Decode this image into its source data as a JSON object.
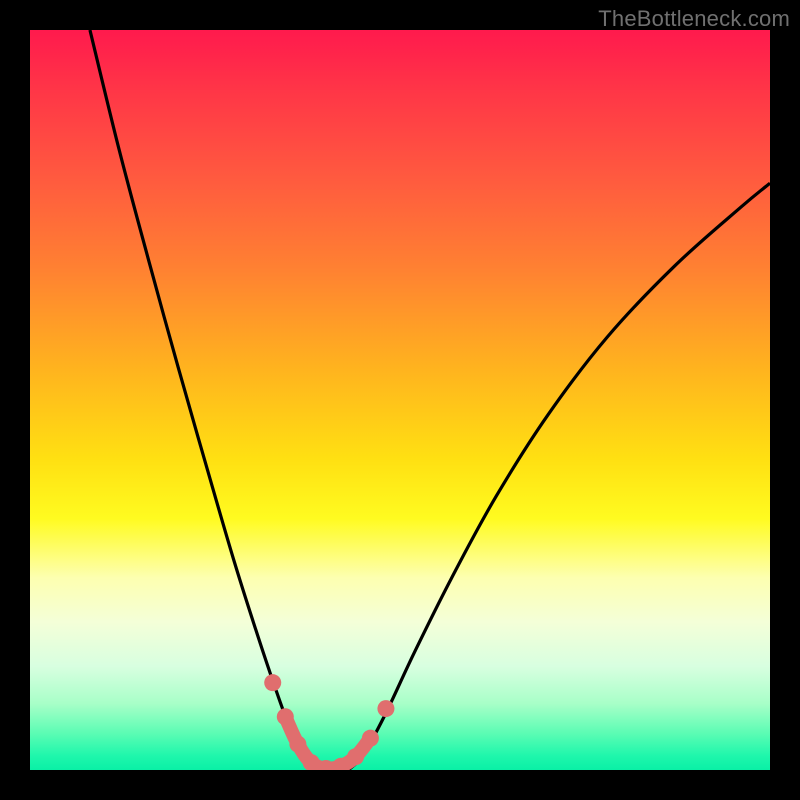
{
  "watermark": "TheBottleneck.com",
  "colors": {
    "frame": "#000000",
    "curve": "#000000",
    "highlight": "#e06e6e",
    "highlight_dot": "#e06e6e"
  },
  "chart_data": {
    "type": "line",
    "title": "",
    "xlabel": "",
    "ylabel": "",
    "xlim": [
      0,
      1
    ],
    "ylim": [
      0,
      1
    ],
    "series": [
      {
        "name": "left-curve",
        "points": [
          {
            "x": 0.081,
            "y": 1.0
          },
          {
            "x": 0.12,
            "y": 0.84
          },
          {
            "x": 0.16,
            "y": 0.69
          },
          {
            "x": 0.2,
            "y": 0.545
          },
          {
            "x": 0.24,
            "y": 0.405
          },
          {
            "x": 0.275,
            "y": 0.285
          },
          {
            "x": 0.305,
            "y": 0.19
          },
          {
            "x": 0.33,
            "y": 0.115
          },
          {
            "x": 0.35,
            "y": 0.06
          },
          {
            "x": 0.37,
            "y": 0.018
          },
          {
            "x": 0.385,
            "y": 0.0
          }
        ]
      },
      {
        "name": "right-curve",
        "points": [
          {
            "x": 0.43,
            "y": 0.0
          },
          {
            "x": 0.45,
            "y": 0.02
          },
          {
            "x": 0.48,
            "y": 0.075
          },
          {
            "x": 0.52,
            "y": 0.16
          },
          {
            "x": 0.57,
            "y": 0.26
          },
          {
            "x": 0.63,
            "y": 0.37
          },
          {
            "x": 0.7,
            "y": 0.48
          },
          {
            "x": 0.78,
            "y": 0.585
          },
          {
            "x": 0.87,
            "y": 0.68
          },
          {
            "x": 0.96,
            "y": 0.76
          },
          {
            "x": 1.0,
            "y": 0.793
          }
        ]
      },
      {
        "name": "valley-highlight",
        "points": [
          {
            "x": 0.345,
            "y": 0.072
          },
          {
            "x": 0.362,
            "y": 0.035
          },
          {
            "x": 0.38,
            "y": 0.01
          },
          {
            "x": 0.4,
            "y": 0.002
          },
          {
            "x": 0.42,
            "y": 0.005
          },
          {
            "x": 0.44,
            "y": 0.018
          },
          {
            "x": 0.46,
            "y": 0.043
          }
        ]
      },
      {
        "name": "valley-dots",
        "points": [
          {
            "x": 0.328,
            "y": 0.118
          },
          {
            "x": 0.345,
            "y": 0.072
          },
          {
            "x": 0.362,
            "y": 0.035
          },
          {
            "x": 0.38,
            "y": 0.01
          },
          {
            "x": 0.4,
            "y": 0.002
          },
          {
            "x": 0.42,
            "y": 0.005
          },
          {
            "x": 0.44,
            "y": 0.018
          },
          {
            "x": 0.46,
            "y": 0.043
          },
          {
            "x": 0.481,
            "y": 0.083
          }
        ]
      }
    ]
  }
}
